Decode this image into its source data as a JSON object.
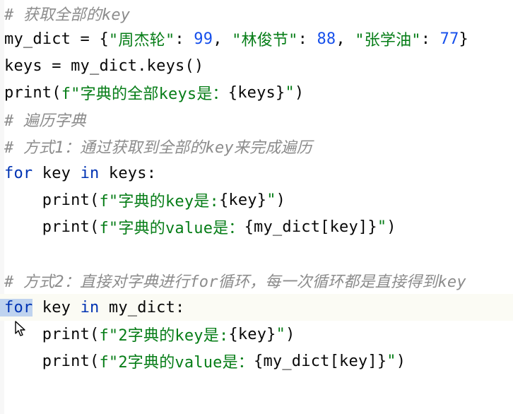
{
  "lines": [
    {
      "text": "# 获取全部的key"
    },
    {
      "segments": [
        "my_dict = {",
        "\"周杰轮\"",
        ": ",
        "99",
        ", ",
        "\"林俊节\"",
        ": ",
        "88",
        ", ",
        "\"张学油\"",
        ": ",
        "77",
        "}"
      ]
    },
    {
      "text": "keys = my_dict.keys()"
    },
    {
      "segments": [
        "print",
        "(",
        "f\"字典的全部keys是：",
        "{keys}",
        "\"",
        ")"
      ]
    },
    {
      "text": "# 遍历字典"
    },
    {
      "text": "# 方式1：通过获取到全部的key来完成遍历"
    },
    {
      "segments": [
        "for",
        " key ",
        "in",
        " keys:"
      ]
    },
    {
      "segments": [
        "    ",
        "print",
        "(",
        "f\"字典的key是:",
        "{key}",
        "\"",
        ")"
      ]
    },
    {
      "segments": [
        "    ",
        "print",
        "(",
        "f\"字典的value是：",
        "{my_dict[key]}",
        "\"",
        ")"
      ]
    },
    {
      "text": ""
    },
    {
      "text": "# 方式2：直接对字典进行for循环，每一次循环都是直接得到key"
    },
    {
      "segments": [
        "for",
        " key ",
        "in",
        " my_dict:"
      ]
    },
    {
      "segments": [
        "    ",
        "print",
        "(",
        "f\"2字典的key是:",
        "{key}",
        "\"",
        ")"
      ]
    },
    {
      "segments": [
        "    ",
        "print",
        "(",
        "f\"2字典的value是：",
        "{my_dict[key]}",
        "\"",
        ")"
      ]
    }
  ],
  "colors": {
    "comment": "#8c8c8c",
    "string": "#067d17",
    "number": "#1750eb",
    "keyword": "#0033b3",
    "selection": "#bfd3ef"
  },
  "icons": {
    "cursor": "mouse-pointer-icon"
  }
}
